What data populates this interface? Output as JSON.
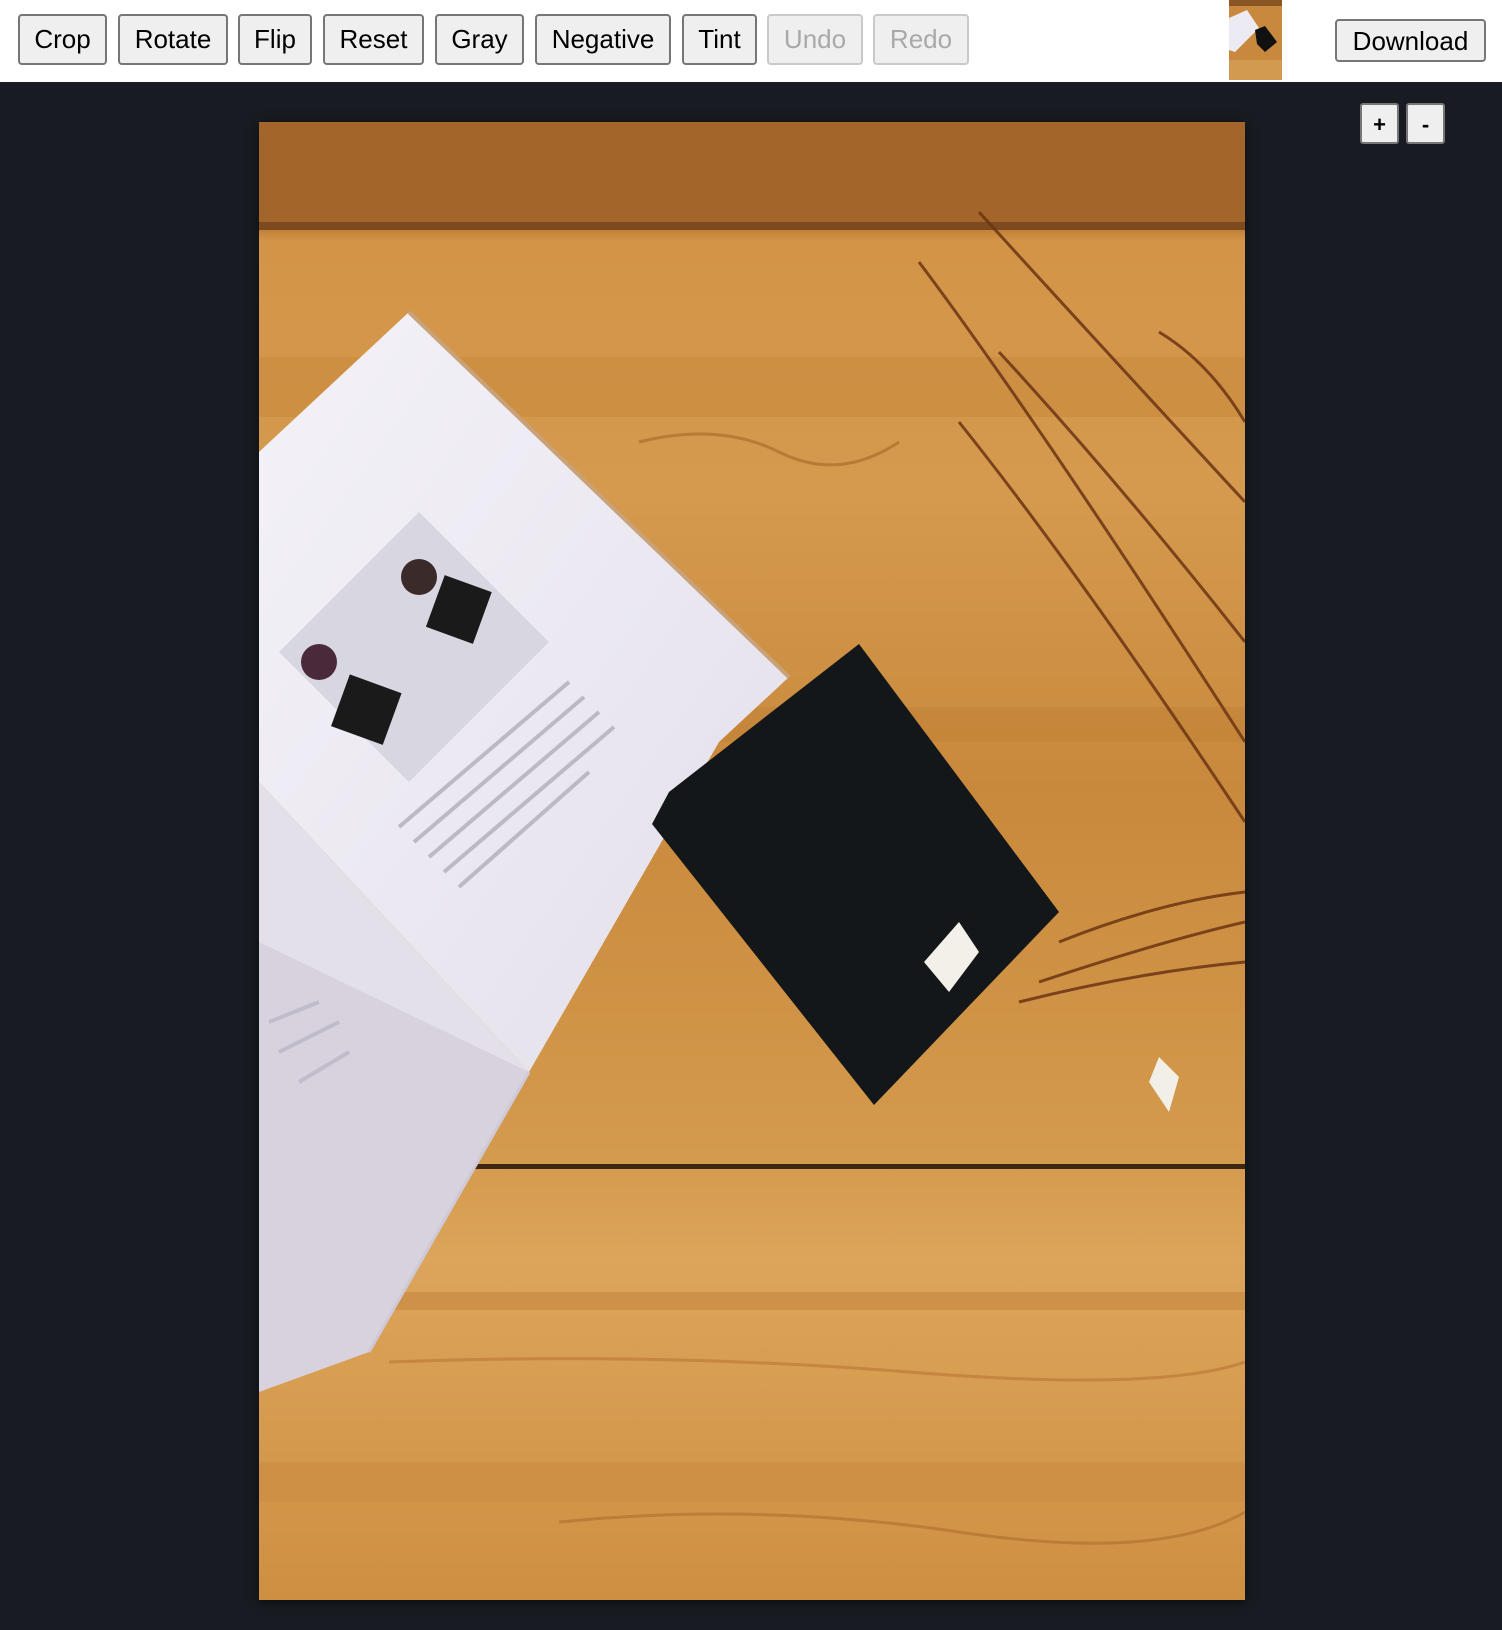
{
  "toolbar": {
    "buttons": [
      {
        "label": "Crop",
        "enabled": true
      },
      {
        "label": "Rotate",
        "enabled": true
      },
      {
        "label": "Flip",
        "enabled": true
      },
      {
        "label": "Reset",
        "enabled": true
      },
      {
        "label": "Gray",
        "enabled": true
      },
      {
        "label": "Negative",
        "enabled": true
      },
      {
        "label": "Tint",
        "enabled": true
      },
      {
        "label": "Undo",
        "enabled": false
      },
      {
        "label": "Redo",
        "enabled": false
      }
    ],
    "download_label": "Download",
    "thumbnail_icon": "image-thumbnail"
  },
  "canvas": {
    "zoom_in_label": "+",
    "zoom_out_label": "-",
    "image_description_icon": "photo-open-book-on-wooden-table"
  },
  "colors": {
    "stage_background": "#181c22",
    "toolbar_background": "#ffffff",
    "button_background": "#efefef",
    "disabled_text": "#a9a9a9"
  }
}
